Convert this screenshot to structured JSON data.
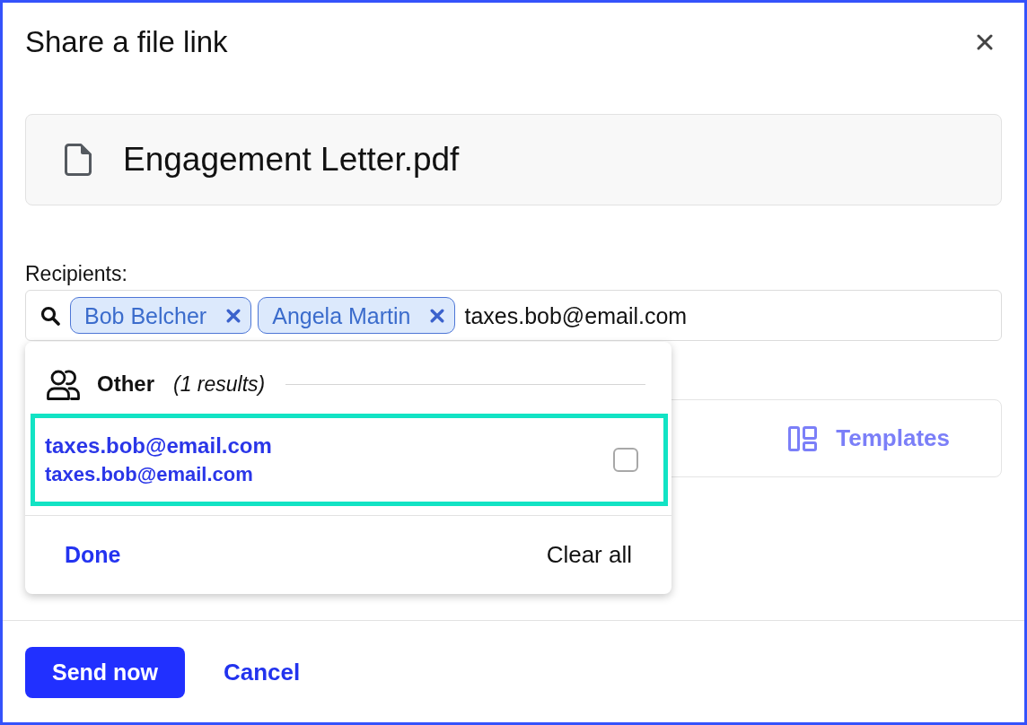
{
  "dialog": {
    "title": "Share a file link"
  },
  "file": {
    "name": "Engagement Letter.pdf"
  },
  "recipients": {
    "label": "Recipients:",
    "chips": [
      {
        "label": "Bob Belcher"
      },
      {
        "label": "Angela Martin"
      }
    ],
    "value": "taxes.bob@email.com"
  },
  "templates_button": {
    "label": "Templates"
  },
  "dropdown": {
    "group": {
      "title": "Other",
      "count": "(1 results)"
    },
    "results": [
      {
        "name": "taxes.bob@email.com",
        "email": "taxes.bob@email.com",
        "highlighted": true,
        "checked": false
      }
    ],
    "done": "Done",
    "clear_all": "Clear all"
  },
  "actions": {
    "primary": "Send now",
    "secondary": "Cancel"
  }
}
